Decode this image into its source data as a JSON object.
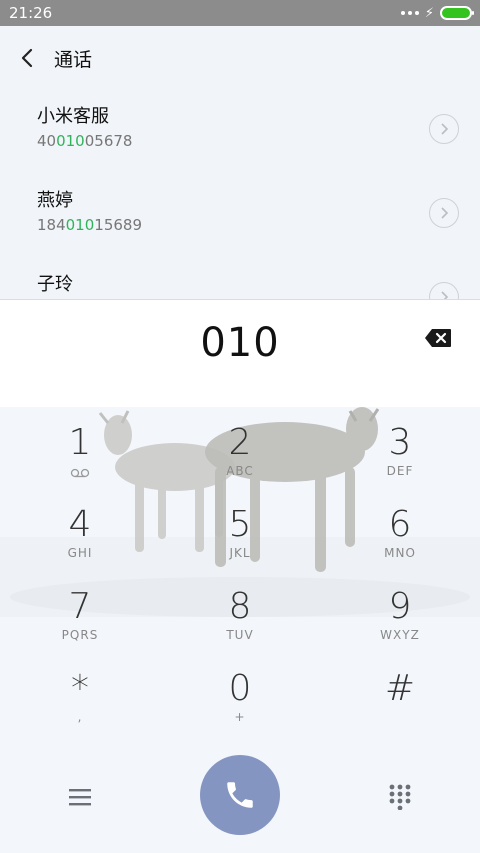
{
  "status": {
    "time": "21:26"
  },
  "header": {
    "title": "通话"
  },
  "contacts": [
    {
      "name": "小米客服",
      "number_pre": "40",
      "number_match": "010",
      "number_post": "05678"
    },
    {
      "name": "燕婷",
      "number_pre": "184",
      "number_match": "010",
      "number_post": "15689"
    },
    {
      "name": "子玲",
      "number_pre": "",
      "number_match": "",
      "number_post": ""
    }
  ],
  "display": {
    "number": "010"
  },
  "keys": [
    {
      "digit": "1",
      "letters": ""
    },
    {
      "digit": "2",
      "letters": "ABC"
    },
    {
      "digit": "3",
      "letters": "DEF"
    },
    {
      "digit": "4",
      "letters": "GHI"
    },
    {
      "digit": "5",
      "letters": "JKL"
    },
    {
      "digit": "6",
      "letters": "MNO"
    },
    {
      "digit": "7",
      "letters": "PQRS"
    },
    {
      "digit": "8",
      "letters": "TUV"
    },
    {
      "digit": "9",
      "letters": "WXYZ"
    },
    {
      "digit": "*",
      "letters": ","
    },
    {
      "digit": "0",
      "letters": "+"
    },
    {
      "digit": "#",
      "letters": ""
    }
  ],
  "colors": {
    "match_highlight": "#31b35c",
    "call_button": "#8595c2",
    "status_bar": "#8c8c8c",
    "battery": "#35c41f"
  },
  "icons": {
    "back": "chevron-left-icon",
    "detail": "chevron-right-circle-icon",
    "backspace": "backspace-icon",
    "voicemail": "voicemail-icon",
    "menu": "menu-icon",
    "call": "phone-icon",
    "dialpad": "dialpad-icon"
  }
}
